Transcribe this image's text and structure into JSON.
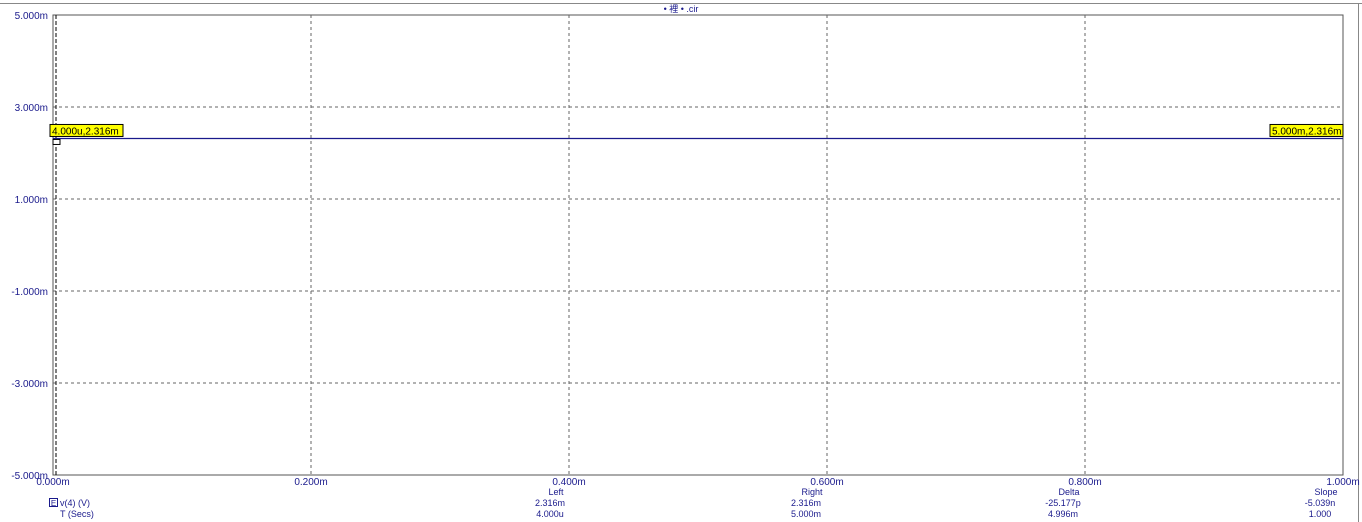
{
  "window": {
    "title": "• 裡 • .cir"
  },
  "chart_data": {
    "type": "line",
    "x_ticks": [
      "0.000m",
      "0.200m",
      "0.400m",
      "0.600m",
      "0.800m",
      "1.000m"
    ],
    "y_ticks": [
      "5.000m",
      "3.000m",
      "1.000m",
      "-1.000m",
      "-3.000m",
      "-5.000m"
    ],
    "xlim": [
      0,
      0.001
    ],
    "ylim": [
      -0.005,
      0.005
    ],
    "grid": true,
    "series": [
      {
        "name": "v(4) (V)",
        "color": "#1a1a8c",
        "x": [
          0.0,
          0.001
        ],
        "y": [
          0.002316,
          0.002316
        ]
      }
    ],
    "cursor_labels": [
      {
        "text": "4.000u,2.316m",
        "x": 0.0,
        "y": 0.002316
      },
      {
        "text": "5.000m,2.316m",
        "x": 0.001,
        "y": 0.002316
      }
    ]
  },
  "readout": {
    "trace_icon": "E",
    "trace_name": "v(4) (V)",
    "x_name": "T (Secs)",
    "columns": [
      {
        "header": "Left",
        "value1": "2.316m",
        "value2": "4.000u"
      },
      {
        "header": "Right",
        "value1": "2.316m",
        "value2": "5.000m"
      },
      {
        "header": "Delta",
        "value1": "-25.177p",
        "value2": "4.996m"
      },
      {
        "header": "Slope",
        "value1": "-5.039n",
        "value2": "1.000"
      }
    ]
  }
}
